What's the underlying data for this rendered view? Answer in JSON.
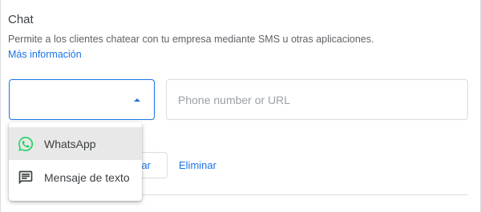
{
  "chat": {
    "title": "Chat",
    "description": "Permite a los clientes chatear con tu empresa mediante SMS u otras aplicaciones.",
    "more_info_link": "Más información"
  },
  "chat_type_select": {
    "selected": ""
  },
  "phone_input": {
    "value": "",
    "placeholder": "Phone number or URL"
  },
  "actions": {
    "add_partial": "ar",
    "delete": "Eliminar"
  },
  "dropdown": {
    "items": [
      {
        "label": "WhatsApp",
        "icon": "whatsapp-icon",
        "highlighted": true,
        "color": "#25d366"
      },
      {
        "label": "Mensaje de texto",
        "icon": "message-icon",
        "highlighted": false,
        "color": "#3c4043"
      }
    ]
  },
  "colors": {
    "accent": "#1a73e8",
    "text": "#3c4043",
    "muted": "#5f6368",
    "border": "#dadce0"
  }
}
